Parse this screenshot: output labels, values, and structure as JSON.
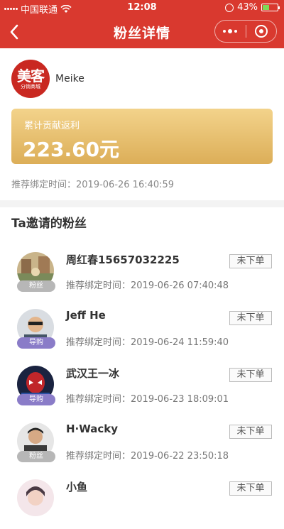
{
  "status_bar": {
    "carrier": "中国联通",
    "time": "12:08",
    "battery": "43%",
    "battery_level": 0.43,
    "battery_color": "#7ed957"
  },
  "nav": {
    "title": "粉丝详情",
    "back_icon": "chevron-left-icon",
    "more_icon": "more-dots-icon",
    "close_icon": "target-circle-icon",
    "bg_color": "#d9392f"
  },
  "profile": {
    "logo_main": "美客",
    "logo_sub": "分销商城",
    "name": "Meike"
  },
  "earnings": {
    "label": "累计贡献返利",
    "amount": "223.60元"
  },
  "bind_time": "推荐绑定时间：2019-06-26 16:40:59",
  "section_title": "Ta邀请的粉丝",
  "fans": [
    {
      "name": "周红春15657032225",
      "tag": "粉丝",
      "time": "推荐绑定时间：2019-06-26 07:40:48",
      "status": "未下单"
    },
    {
      "name": "Jeff He",
      "tag": "导购",
      "time": "推荐绑定时间：2019-06-24 11:59:40",
      "status": "未下单"
    },
    {
      "name": "武汉王一冰",
      "tag": "导购",
      "time": "推荐绑定时间：2019-06-23 18:09:01",
      "status": "未下单"
    },
    {
      "name": "H·Wacky",
      "tag": "粉丝",
      "time": "推荐绑定时间：2019-06-22 23:50:18",
      "status": "未下单"
    },
    {
      "name": "小鱼",
      "tag": "",
      "time": "",
      "status": "未下单"
    }
  ]
}
